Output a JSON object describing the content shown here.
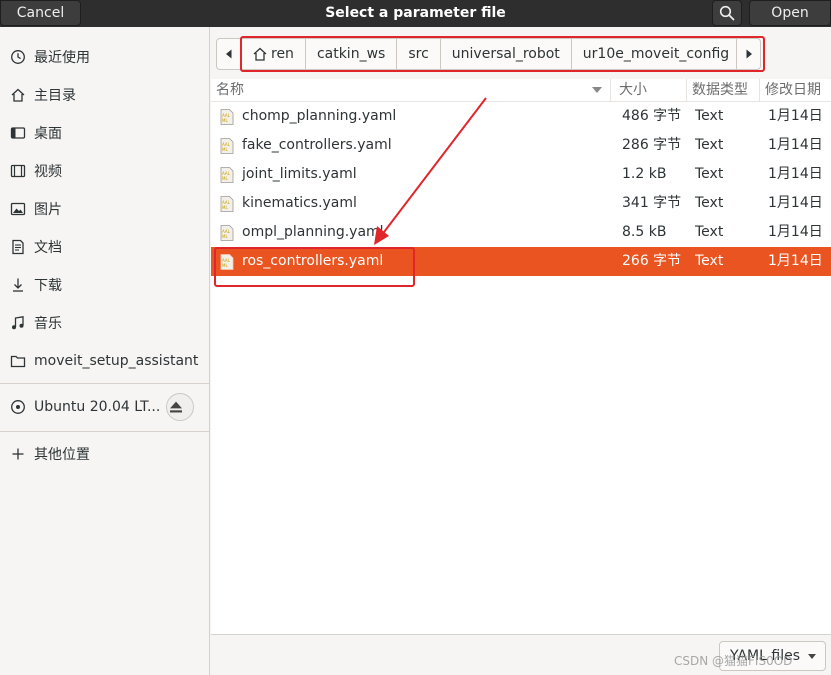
{
  "header": {
    "cancel_label": "Cancel",
    "title": "Select a parameter file",
    "open_label": "Open"
  },
  "sidebar": {
    "places": [
      {
        "label": "最近使用",
        "icon": "recent-icon"
      },
      {
        "label": "主目录",
        "icon": "home-icon"
      },
      {
        "label": "桌面",
        "icon": "desktop-icon"
      },
      {
        "label": "视频",
        "icon": "video-icon"
      },
      {
        "label": "图片",
        "icon": "picture-icon"
      },
      {
        "label": "文档",
        "icon": "document-icon"
      },
      {
        "label": "下载",
        "icon": "download-icon"
      },
      {
        "label": "音乐",
        "icon": "music-icon"
      },
      {
        "label": "moveit_setup_assistant",
        "icon": "folder-icon"
      }
    ],
    "devices": [
      {
        "label": "Ubuntu 20.04 LT...",
        "icon": "disc-icon"
      }
    ],
    "other": {
      "label": "其他位置",
      "icon": "plus-icon"
    }
  },
  "pathbar": {
    "crumbs": [
      "ren",
      "catkin_ws",
      "src",
      "universal_robot",
      "ur10e_moveit_config"
    ]
  },
  "filelist": {
    "columns": {
      "name": "名称",
      "size": "大小",
      "type": "数据类型",
      "modified": "修改日期"
    },
    "rows": [
      {
        "name": "chomp_planning.yaml",
        "size": "486 字节",
        "type": "Text",
        "modified": "1月14日",
        "selected": false
      },
      {
        "name": "fake_controllers.yaml",
        "size": "286 字节",
        "type": "Text",
        "modified": "1月14日",
        "selected": false
      },
      {
        "name": "joint_limits.yaml",
        "size": "1.2 kB",
        "type": "Text",
        "modified": "1月14日",
        "selected": false
      },
      {
        "name": "kinematics.yaml",
        "size": "341 字节",
        "type": "Text",
        "modified": "1月14日",
        "selected": false
      },
      {
        "name": "ompl_planning.yaml",
        "size": "8.5 kB",
        "type": "Text",
        "modified": "1月14日",
        "selected": false
      },
      {
        "name": "ros_controllers.yaml",
        "size": "266 字节",
        "type": "Text",
        "modified": "1月14日",
        "selected": true
      }
    ]
  },
  "footer": {
    "filter_label": "YAML files"
  },
  "watermark": "CSDN @猫猫FIS0OD",
  "colors": {
    "accent": "#e95420",
    "annotation": "#e0252b",
    "headerbar": "#2e2e2e"
  }
}
